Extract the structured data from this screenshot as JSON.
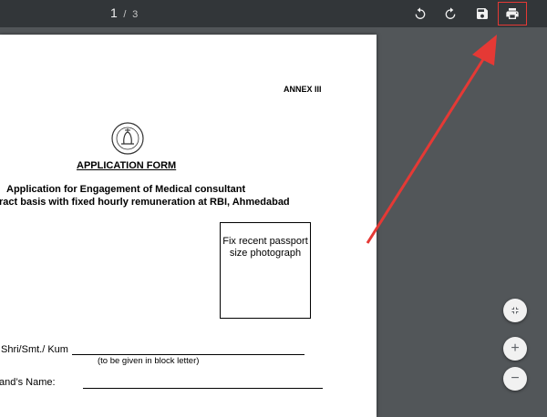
{
  "toolbar": {
    "current_page": "1",
    "page_separator": "/",
    "total_pages": "3"
  },
  "document": {
    "annex": "ANNEX III",
    "title": "APPLICATION FORM",
    "subtitle_line1": "Application for Engagement of Medical consultant",
    "subtitle_line2": "ract basis with fixed hourly remuneration at RBI, Ahmedabad",
    "photo_box_text": "Fix recent passport size photograph",
    "field_name_label": " Shri/Smt./ Kum",
    "field_name_hint": "(to be given in block letter)",
    "field_husband_label": "and’s Name:"
  },
  "zoom_controls": {
    "fit_icon": "fit-to-page-icon",
    "zoom_in_symbol": "+",
    "zoom_out_symbol": "−"
  },
  "annotation": {
    "arrow_color": "#e53935"
  }
}
